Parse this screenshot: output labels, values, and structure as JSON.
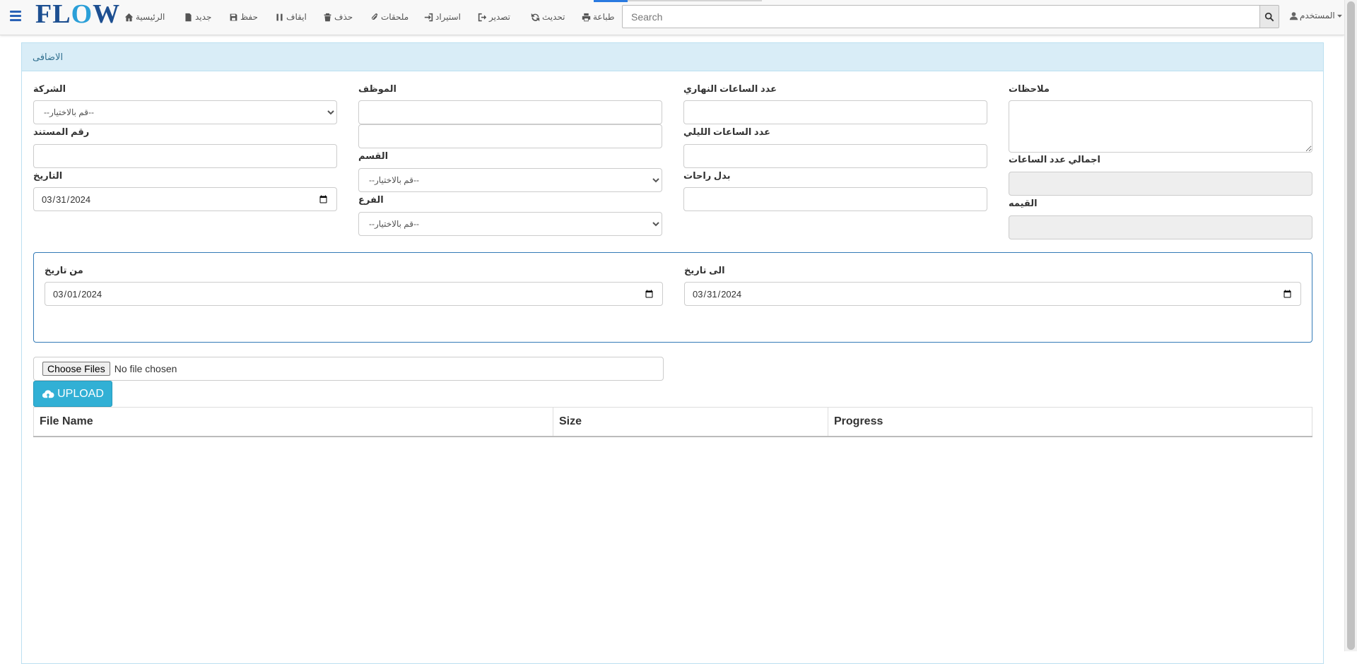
{
  "app": {
    "logo_text": "FLOW"
  },
  "toolbar": {
    "home": "الرئيسية",
    "new": "جديد",
    "save": "حفظ",
    "stop": "ايقاف",
    "delete": "حذف",
    "attachments": "ملحقات",
    "import": "استيراد",
    "export": "تصدير",
    "refresh": "تحديث",
    "print": "طباعة",
    "search_placeholder": "Search",
    "user": "المستخدم"
  },
  "panel": {
    "title": "الاضافى"
  },
  "form": {
    "company": {
      "label": "الشركة",
      "placeholder": "--قم بالاختيار--"
    },
    "employee": {
      "label": "الموظف",
      "value": "",
      "value2": ""
    },
    "day_hours": {
      "label": "عدد الساعات النهاري",
      "value": ""
    },
    "notes": {
      "label": "ملاحظات",
      "value": ""
    },
    "doc_number": {
      "label": "رقم المستند",
      "value": ""
    },
    "night_hours": {
      "label": "عدد الساعات الليلي",
      "value": ""
    },
    "total_hours": {
      "label": "اجمالي عدد الساعات",
      "value": ""
    },
    "department": {
      "label": "القسم",
      "placeholder": "--قم بالاختيار--"
    },
    "date": {
      "label": "التاريخ",
      "value": "2024-03-31"
    },
    "rest_allowance": {
      "label": "بدل راحات",
      "value": ""
    },
    "value": {
      "label": "القيمه",
      "value": ""
    },
    "branch": {
      "label": "الفرع",
      "placeholder": "--قم بالاختيار--"
    }
  },
  "date_range": {
    "from": {
      "label": "من تاريخ",
      "value": "2024-03-01"
    },
    "to": {
      "label": "الى تاريخ",
      "value": "2024-03-31"
    }
  },
  "upload": {
    "choose_label": "Choose Files",
    "no_file": "No file chosen",
    "button_label": "UPLOAD",
    "columns": [
      "File Name",
      "Size",
      "Progress"
    ]
  }
}
